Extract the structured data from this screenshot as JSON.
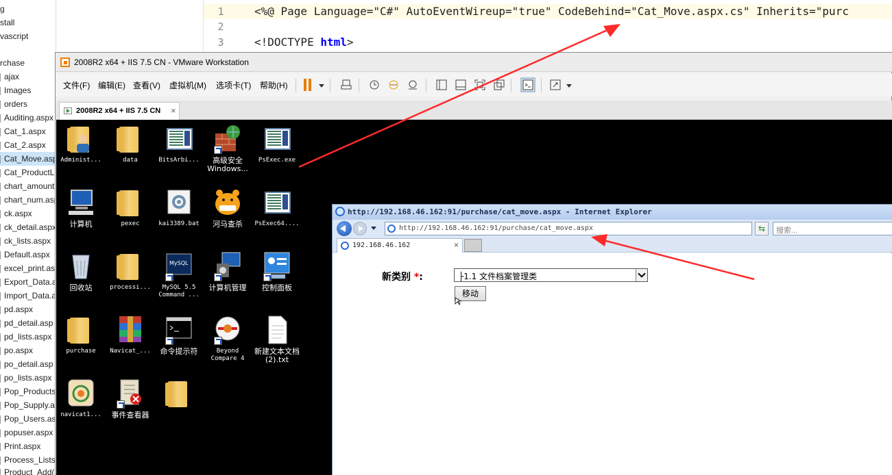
{
  "solution_explorer": {
    "items": [
      {
        "label": "g"
      },
      {
        "label": "stall"
      },
      {
        "label": "vascript"
      },
      {
        "label": "rchase"
      },
      {
        "label": "ajax"
      },
      {
        "label": "Images"
      },
      {
        "label": "orders"
      },
      {
        "label": "Auditing.aspx"
      },
      {
        "label": "Cat_1.aspx"
      },
      {
        "label": "Cat_2.aspx"
      },
      {
        "label": "Cat_Move.aspx"
      },
      {
        "label": "Cat_ProductLi"
      },
      {
        "label": "chart_amount"
      },
      {
        "label": "chart_num.asp"
      },
      {
        "label": "ck.aspx"
      },
      {
        "label": "ck_detail.aspx"
      },
      {
        "label": "ck_lists.aspx"
      },
      {
        "label": "Default.aspx"
      },
      {
        "label": "excel_print.as"
      },
      {
        "label": "Export_Data.a"
      },
      {
        "label": "Import_Data.a"
      },
      {
        "label": "pd.aspx"
      },
      {
        "label": "pd_detail.asp"
      },
      {
        "label": "pd_lists.aspx"
      },
      {
        "label": "po.aspx"
      },
      {
        "label": "po_detail.asp"
      },
      {
        "label": "po_lists.aspx"
      },
      {
        "label": "Pop_Products"
      },
      {
        "label": "Pop_Supply.a"
      },
      {
        "label": "Pop_Users.as"
      },
      {
        "label": "popuser.aspx"
      },
      {
        "label": "Print.aspx"
      },
      {
        "label": "Process_Lists."
      },
      {
        "label": "Product_Add("
      }
    ],
    "selected_index": 10
  },
  "editor": {
    "lines": [
      {
        "number": "1",
        "text": "<%@ Page Language=\"C#\" AutoEventWireup=\"true\" CodeBehind=\"Cat_Move.aspx.cs\" Inherits=\"purc"
      },
      {
        "number": "2",
        "text": ""
      },
      {
        "number": "3",
        "text_prefix": "<!DOCTYPE ",
        "text_keyword": "html",
        "text_suffix": ">"
      }
    ]
  },
  "vmware": {
    "title": "2008R2 x64 + IIS 7.5 CN - VMware Workstation",
    "menu": [
      "文件(F)",
      "编辑(E)",
      "查看(V)",
      "虚拟机(M)",
      "选项卡(T)",
      "帮助(H)"
    ],
    "tab_label": "2008R2 x64 + IIS 7.5 CN",
    "tab_close": "×"
  },
  "desktop_icons": [
    {
      "label": "Administ...",
      "icon": "user-icon"
    },
    {
      "label": "data",
      "icon": "folder-icon"
    },
    {
      "label": "BitsArbi...",
      "icon": "window-icon"
    },
    {
      "label": "高级安全 Windows...",
      "icon": "firewall-icon"
    },
    {
      "label": "PsExec.exe",
      "icon": "window-icon"
    },
    {
      "label": "计算机",
      "icon": "computer-icon"
    },
    {
      "label": "pexec",
      "icon": "folder-icon"
    },
    {
      "label": "kai3389.bat",
      "icon": "gear-icon"
    },
    {
      "label": "河马查杀",
      "icon": "hippo-icon"
    },
    {
      "label": "PsExec64....",
      "icon": "window-icon"
    },
    {
      "label": "回收站",
      "icon": "recycle-bin-icon"
    },
    {
      "label": "processi...",
      "icon": "folder-icon"
    },
    {
      "label": "MySQL 5.5 Command ...",
      "icon": "mysql-icon"
    },
    {
      "label": "计算机管理",
      "icon": "computer-management-icon"
    },
    {
      "label": "控制面板",
      "icon": "control-panel-icon"
    },
    {
      "label": "purchase",
      "icon": "folder-icon"
    },
    {
      "label": "Navicat_...",
      "icon": "winrar-icon"
    },
    {
      "label": "命令提示符",
      "icon": "cmd-icon"
    },
    {
      "label": "Beyond Compare 4",
      "icon": "beyond-compare-icon"
    },
    {
      "label": "新建文本文档 (2).txt",
      "icon": "text-file-icon"
    },
    {
      "label": "navicat1...",
      "icon": "navicat-icon"
    },
    {
      "label": "事件查看器",
      "icon": "event-viewer-icon"
    },
    {
      "label": "",
      "icon": "folder-icon"
    }
  ],
  "ie": {
    "title": "http://192.168.46.162:91/purchase/cat_move.aspx - Internet Explorer",
    "url": "http://192.168.46.162:91/purchase/cat_move.aspx",
    "search_placeholder": "搜索...",
    "tab_label": "192.168.46.162",
    "tab_close": "×",
    "form": {
      "label": "新类别",
      "required_mark": "*",
      "colon": ":",
      "select_value": "├1.1 文件档案管理类",
      "button_label": "移动"
    }
  },
  "colors": {
    "annotation_arrow": "#ff2a2a",
    "desktop_bg": "#000000",
    "required": "#e00000"
  }
}
